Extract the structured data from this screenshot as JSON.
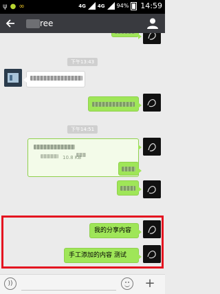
{
  "status_bar": {
    "network1": "4G",
    "network2": "4G",
    "battery": "94%",
    "time": "14:59"
  },
  "header": {
    "title": "ree"
  },
  "timestamps": {
    "t1": "下午13:43",
    "t2": "下午14:51"
  },
  "file": {
    "size": "10.8 KB"
  },
  "messages": {
    "shared": "我的分享内容",
    "added": "手工添加的内容 测试"
  },
  "colors": {
    "outgoing_bubble": "#9fe658",
    "title_bar": "#393a3f",
    "highlight": "#e4131f"
  }
}
